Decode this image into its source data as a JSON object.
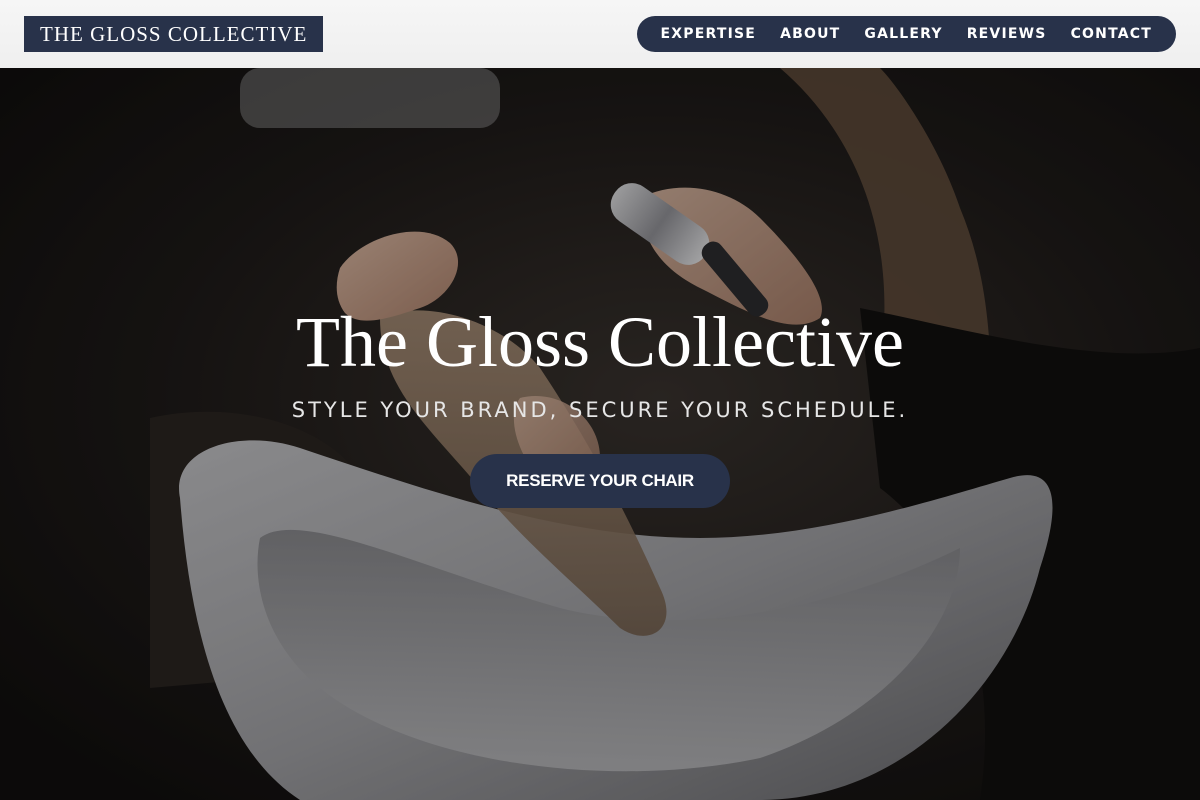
{
  "brand": {
    "logo_text": "THE GLOSS COLLECTIVE"
  },
  "nav": {
    "items": [
      {
        "label": "EXPERTISE"
      },
      {
        "label": "ABOUT"
      },
      {
        "label": "GALLERY"
      },
      {
        "label": "REVIEWS"
      },
      {
        "label": "CONTACT"
      }
    ]
  },
  "hero": {
    "title": "The Gloss Collective",
    "tagline": "STYLE YOUR BRAND, SECURE YOUR SCHEDULE.",
    "cta_label": "RESERVE YOUR CHAIR"
  },
  "colors": {
    "brand_navy": "#28324a",
    "header_bg": "#f2f2f2",
    "hero_text": "#ffffff"
  }
}
